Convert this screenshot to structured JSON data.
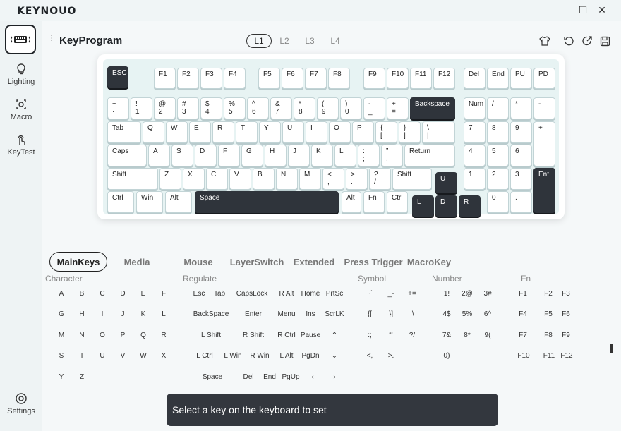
{
  "app": {
    "logo": "KEYNOUO"
  },
  "window": {
    "minimize": "—",
    "maximize": "☐",
    "close": "✕"
  },
  "sidebar": {
    "items": [
      {
        "label": "Lighting",
        "icon": "bulb-icon"
      },
      {
        "label": "Macro",
        "icon": "macro-icon"
      },
      {
        "label": "KeyTest",
        "icon": "touch-icon"
      }
    ],
    "settings": "Settings"
  },
  "header": {
    "title": "KeyProgram",
    "layers": [
      "L1",
      "L2",
      "L3",
      "L4"
    ],
    "active_layer": "L1"
  },
  "keyboard": {
    "keys": [
      {
        "id": "esc",
        "l": "ESC",
        "dark": true
      },
      {
        "id": "f1",
        "l": "F1"
      },
      {
        "id": "f2",
        "l": "F2"
      },
      {
        "id": "f3",
        "l": "F3"
      },
      {
        "id": "f4",
        "l": "F4"
      },
      {
        "id": "f5",
        "l": "F5"
      },
      {
        "id": "f6",
        "l": "F6"
      },
      {
        "id": "f7",
        "l": "F7"
      },
      {
        "id": "f8",
        "l": "F8"
      },
      {
        "id": "f9",
        "l": "F9"
      },
      {
        "id": "f10",
        "l": "F10"
      },
      {
        "id": "f11",
        "l": "F11"
      },
      {
        "id": "f12",
        "l": "F12"
      },
      {
        "id": "del",
        "l": "Del"
      },
      {
        "id": "end",
        "l": "End"
      },
      {
        "id": "pu",
        "l": "PU"
      },
      {
        "id": "pd",
        "l": "PD"
      },
      {
        "id": "tilde",
        "l": "~\n·"
      },
      {
        "id": "n1",
        "l": "!\n1"
      },
      {
        "id": "n2",
        "l": "@\n2"
      },
      {
        "id": "n3",
        "l": "#\n3"
      },
      {
        "id": "n4",
        "l": "$\n4"
      },
      {
        "id": "n5",
        "l": "%\n5"
      },
      {
        "id": "n6",
        "l": "^\n6"
      },
      {
        "id": "n7",
        "l": "&\n7"
      },
      {
        "id": "n8",
        "l": "*\n8"
      },
      {
        "id": "n9",
        "l": "(\n9"
      },
      {
        "id": "n0",
        "l": ")\n0"
      },
      {
        "id": "minus",
        "l": "-\n_"
      },
      {
        "id": "equal",
        "l": "+\n="
      },
      {
        "id": "backspace",
        "l": "Backspace",
        "dark": true
      },
      {
        "id": "num",
        "l": "Num"
      },
      {
        "id": "kpslash",
        "l": "/"
      },
      {
        "id": "kpstar",
        "l": "*"
      },
      {
        "id": "kpminus",
        "l": "-"
      },
      {
        "id": "tab",
        "l": "Tab"
      },
      {
        "id": "q",
        "l": "Q"
      },
      {
        "id": "w",
        "l": "W"
      },
      {
        "id": "e",
        "l": "E"
      },
      {
        "id": "r",
        "l": "R"
      },
      {
        "id": "t",
        "l": "T"
      },
      {
        "id": "y",
        "l": "Y"
      },
      {
        "id": "u",
        "l": "U"
      },
      {
        "id": "i",
        "l": "I"
      },
      {
        "id": "o",
        "l": "O"
      },
      {
        "id": "p",
        "l": "P"
      },
      {
        "id": "lbr",
        "l": "{\n["
      },
      {
        "id": "rbr",
        "l": "}\n]"
      },
      {
        "id": "bsl",
        "l": "\\\n|"
      },
      {
        "id": "kp7",
        "l": "7"
      },
      {
        "id": "kp8",
        "l": "8"
      },
      {
        "id": "kp9",
        "l": "9"
      },
      {
        "id": "kpplus",
        "l": "+"
      },
      {
        "id": "caps",
        "l": "Caps"
      },
      {
        "id": "a",
        "l": "A"
      },
      {
        "id": "s",
        "l": "S"
      },
      {
        "id": "d",
        "l": "D"
      },
      {
        "id": "f",
        "l": "F"
      },
      {
        "id": "g",
        "l": "G"
      },
      {
        "id": "h",
        "l": "H"
      },
      {
        "id": "j",
        "l": "J"
      },
      {
        "id": "k",
        "l": "K"
      },
      {
        "id": "l",
        "l": "L"
      },
      {
        "id": "semi",
        "l": ":\n;"
      },
      {
        "id": "quote",
        "l": "”\n,"
      },
      {
        "id": "return",
        "l": "Return"
      },
      {
        "id": "kp4",
        "l": "4"
      },
      {
        "id": "kp5",
        "l": "5"
      },
      {
        "id": "kp6",
        "l": "6"
      },
      {
        "id": "lshift",
        "l": "Shift"
      },
      {
        "id": "z",
        "l": "Z"
      },
      {
        "id": "x",
        "l": "X"
      },
      {
        "id": "c",
        "l": "C"
      },
      {
        "id": "v",
        "l": "V"
      },
      {
        "id": "b",
        "l": "B"
      },
      {
        "id": "n",
        "l": "N"
      },
      {
        "id": "m",
        "l": "M"
      },
      {
        "id": "comma",
        "l": "<\n,"
      },
      {
        "id": "period",
        "l": ">\n."
      },
      {
        "id": "slash",
        "l": "?\n/"
      },
      {
        "id": "rshift",
        "l": "Shift"
      },
      {
        "id": "up",
        "l": "U",
        "dark": true
      },
      {
        "id": "kp1",
        "l": "1"
      },
      {
        "id": "kp2",
        "l": "2"
      },
      {
        "id": "kp3",
        "l": "3"
      },
      {
        "id": "kpent",
        "l": "Ent",
        "dark": true
      },
      {
        "id": "lctrl",
        "l": "Ctrl"
      },
      {
        "id": "win",
        "l": "Win"
      },
      {
        "id": "lalt",
        "l": "Alt"
      },
      {
        "id": "space",
        "l": "Space",
        "dark": true
      },
      {
        "id": "ralt",
        "l": "Alt"
      },
      {
        "id": "fn",
        "l": "Fn"
      },
      {
        "id": "rctrl",
        "l": "Ctrl"
      },
      {
        "id": "left",
        "l": "L",
        "dark": true
      },
      {
        "id": "down",
        "l": "D",
        "dark": true
      },
      {
        "id": "right",
        "l": "R",
        "dark": true
      },
      {
        "id": "kp0",
        "l": "0"
      },
      {
        "id": "kpdot",
        "l": "."
      }
    ]
  },
  "tabs": [
    "MainKeys",
    "Media",
    "Mouse",
    "LayerSwitch",
    "Extended",
    "Press Trigger",
    "MacroKey"
  ],
  "active_tab": "MainKeys",
  "categories": [
    "Character",
    "Regulate",
    "Symbol",
    "Number",
    "Fn"
  ],
  "palette": {
    "character": [
      "A",
      "B",
      "C",
      "D",
      "E",
      "F",
      "G",
      "H",
      "I",
      "J",
      "K",
      "L",
      "M",
      "N",
      "O",
      "P",
      "Q",
      "R",
      "S",
      "T",
      "U",
      "V",
      "W",
      "X",
      "Y",
      "Z"
    ],
    "regulate": [
      "Esc",
      "Tab",
      "CapsLock",
      "R Alt",
      "Home",
      "PrtSc",
      "BackSpace",
      "Enter",
      "Menu",
      "Ins",
      "ScrLK",
      "L Shift",
      "R Shift",
      "R Ctrl",
      "Pause",
      "⌃",
      "L Ctrl",
      "L Win",
      "R Win",
      "L Alt",
      "PgDn",
      "⌄",
      "Space",
      "Del",
      "End",
      "PgUp",
      "‹",
      "›"
    ],
    "symbol": [
      "~`",
      "_-",
      "+=",
      "{[",
      "}]",
      "|\\",
      ":;",
      "“'",
      "?/",
      "<,",
      ">."
    ],
    "number": [
      "1!",
      "2@",
      "3#",
      "4$",
      "5%",
      "6^",
      "7&",
      "8*",
      "9(",
      "0)"
    ],
    "fn": [
      "F1",
      "F2",
      "F3",
      "F4",
      "F5",
      "F6",
      "F7",
      "F8",
      "F9",
      "F10",
      "F11",
      "F12"
    ]
  },
  "toast": "Select a key on the keyboard to set"
}
